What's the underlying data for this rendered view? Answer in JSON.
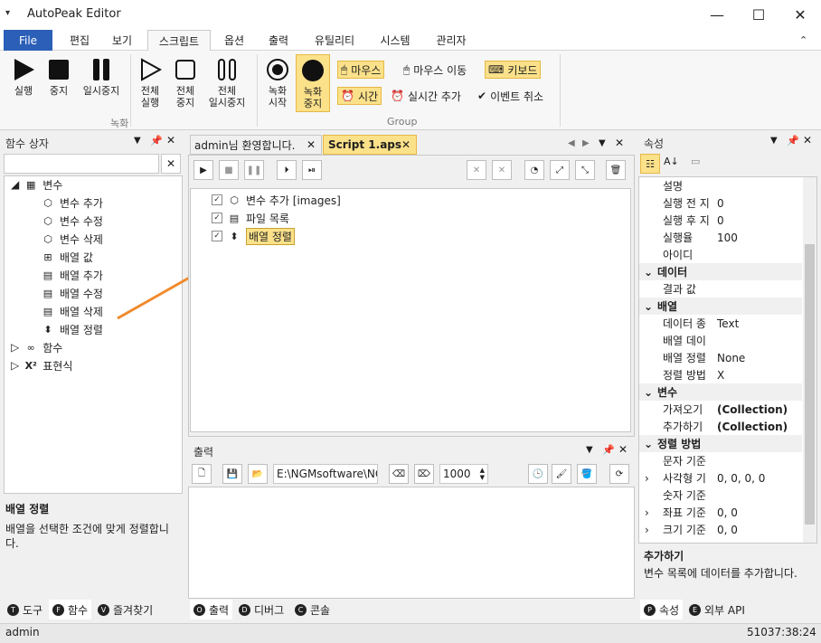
{
  "window": {
    "title": "AutoPeak Editor",
    "menu_glyph": "▾",
    "minimize": "—",
    "maximize": "☐",
    "close": "✕"
  },
  "menu": {
    "file": "File",
    "tabs": [
      "편집",
      "보기",
      "스크립트",
      "옵션",
      "출력",
      "유틸리티",
      "시스템",
      "관리자"
    ],
    "active": "스크립트"
  },
  "ribbon": {
    "run": "실행",
    "stop": "중지",
    "pause": "일시중지",
    "all_run": [
      "전체",
      "실행"
    ],
    "all_stop": [
      "전체",
      "중지"
    ],
    "all_pause": [
      "전체",
      "일시중지"
    ],
    "rec_start": [
      "녹화",
      "시작"
    ],
    "rec_stop": [
      "녹화",
      "중지"
    ],
    "group_record": "녹화",
    "group_group": "Group",
    "mouse": "마우스",
    "mouse_move": "마우스 이동",
    "keyboard": "키보드",
    "time": "시간",
    "realtime_add": "실시간 추가",
    "event_cancel": "이벤트 취소"
  },
  "left_panel": {
    "title": "함수 상자",
    "search_value": "",
    "tree": [
      {
        "label": "변수",
        "level": 0,
        "expanded": true,
        "icon": "variable-icon"
      },
      {
        "label": "변수 추가",
        "level": 1,
        "icon": "cube-add-icon"
      },
      {
        "label": "변수 수정",
        "level": 1,
        "icon": "cube-edit-icon"
      },
      {
        "label": "변수 삭제",
        "level": 1,
        "icon": "cube-delete-icon"
      },
      {
        "label": "배열 값",
        "level": 1,
        "icon": "array-value-icon"
      },
      {
        "label": "배열 추가",
        "level": 1,
        "icon": "array-add-icon"
      },
      {
        "label": "배열 수정",
        "level": 1,
        "icon": "array-edit-icon"
      },
      {
        "label": "배열 삭제",
        "level": 1,
        "icon": "array-delete-icon"
      },
      {
        "label": "배열 정렬",
        "level": 1,
        "icon": "sort-icon"
      },
      {
        "label": "함수",
        "level": 0,
        "expanded": false,
        "icon": "infinity-icon"
      },
      {
        "label": "표현식",
        "level": 0,
        "expanded": false,
        "icon": "x-squared-icon"
      }
    ],
    "desc_title": "배열 정렬",
    "desc_text": "배열을 선택한 조건에 맞게 정렬합니다.",
    "bottom_tabs": [
      "도구",
      "함수",
      "즐겨찾기"
    ]
  },
  "editor": {
    "tabs": [
      "admin님 환영합니다.",
      "Script 1.aps"
    ],
    "active_tab": "Script 1.aps",
    "items": [
      {
        "label": "변수 추가 [images]",
        "checked": true,
        "icon": "cube-add-icon"
      },
      {
        "label": "파일 목록",
        "checked": true,
        "icon": "file-list-icon"
      },
      {
        "label": "배열 정렬",
        "checked": true,
        "icon": "sort-icon",
        "selected": true
      }
    ]
  },
  "output": {
    "title": "출력",
    "path": "E:\\NGMsoftware\\NG",
    "number": "1000",
    "bottom_tabs": [
      "출력",
      "디버그",
      "콘솔"
    ]
  },
  "properties": {
    "title": "속성",
    "rows": [
      {
        "name": "설명",
        "value": "",
        "type": "prop"
      },
      {
        "name": "실행 전 지",
        "value": "0",
        "type": "prop"
      },
      {
        "name": "실행 후 지",
        "value": "0",
        "type": "prop"
      },
      {
        "name": "실행율",
        "value": "100",
        "type": "prop"
      },
      {
        "name": "아이디",
        "value": "",
        "type": "prop"
      },
      {
        "name": "데이터",
        "value": "",
        "type": "cat"
      },
      {
        "name": "결과 값",
        "value": "",
        "type": "prop"
      },
      {
        "name": "배열",
        "value": "",
        "type": "cat"
      },
      {
        "name": "데이터 종",
        "value": "Text",
        "type": "prop"
      },
      {
        "name": "배열 데이",
        "value": "",
        "type": "prop"
      },
      {
        "name": "배열 정렬",
        "value": "None",
        "type": "prop"
      },
      {
        "name": "정렬 방법",
        "value": "X",
        "type": "prop"
      },
      {
        "name": "변수",
        "value": "",
        "type": "cat"
      },
      {
        "name": "가져오기",
        "value": "(Collection)",
        "type": "prop",
        "bold": true
      },
      {
        "name": "추가하기",
        "value": "(Collection)",
        "type": "prop",
        "bold": true
      },
      {
        "name": "정렬 방법",
        "value": "",
        "type": "cat"
      },
      {
        "name": "문자 기준",
        "value": "",
        "type": "prop"
      },
      {
        "name": "사각형 기",
        "value": "0, 0, 0, 0",
        "type": "prop",
        "expand": true
      },
      {
        "name": "숫자 기준",
        "value": "",
        "type": "prop"
      },
      {
        "name": "좌표 기준",
        "value": "0, 0",
        "type": "prop",
        "expand": true
      },
      {
        "name": "크기 기준",
        "value": "0, 0",
        "type": "prop",
        "expand": true
      }
    ],
    "desc_title": "추가하기",
    "desc_text": "변수 목록에 데이터를 추가합니다.",
    "bottom_tabs": [
      "속성",
      "외부 API"
    ]
  },
  "status": {
    "user": "admin",
    "time": "51037:38:24"
  }
}
